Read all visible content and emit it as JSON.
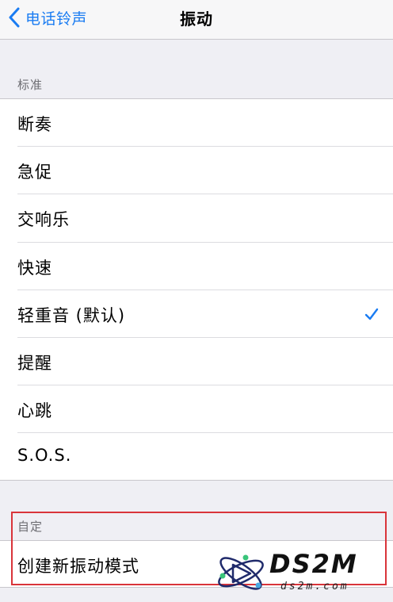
{
  "nav": {
    "back_label": "电话铃声",
    "title": "振动"
  },
  "sections": {
    "standard": {
      "header": "标准",
      "items": [
        {
          "label": "断奏",
          "selected": false
        },
        {
          "label": "急促",
          "selected": false
        },
        {
          "label": "交响乐",
          "selected": false
        },
        {
          "label": "快速",
          "selected": false
        },
        {
          "label": "轻重音 (默认)",
          "selected": true
        },
        {
          "label": "提醒",
          "selected": false
        },
        {
          "label": "心跳",
          "selected": false
        },
        {
          "label": "S.O.S.",
          "selected": false
        }
      ]
    },
    "custom": {
      "header": "自定",
      "items": [
        {
          "label": "创建新振动模式"
        }
      ]
    }
  },
  "watermark": {
    "brand": "DS2M",
    "url": "ds2m.com"
  },
  "colors": {
    "accent": "#1a7cf2",
    "highlight": "#d9343a",
    "background": "#efeff4"
  },
  "icons": {
    "back": "chevron-left-icon",
    "selected": "checkmark-icon"
  }
}
